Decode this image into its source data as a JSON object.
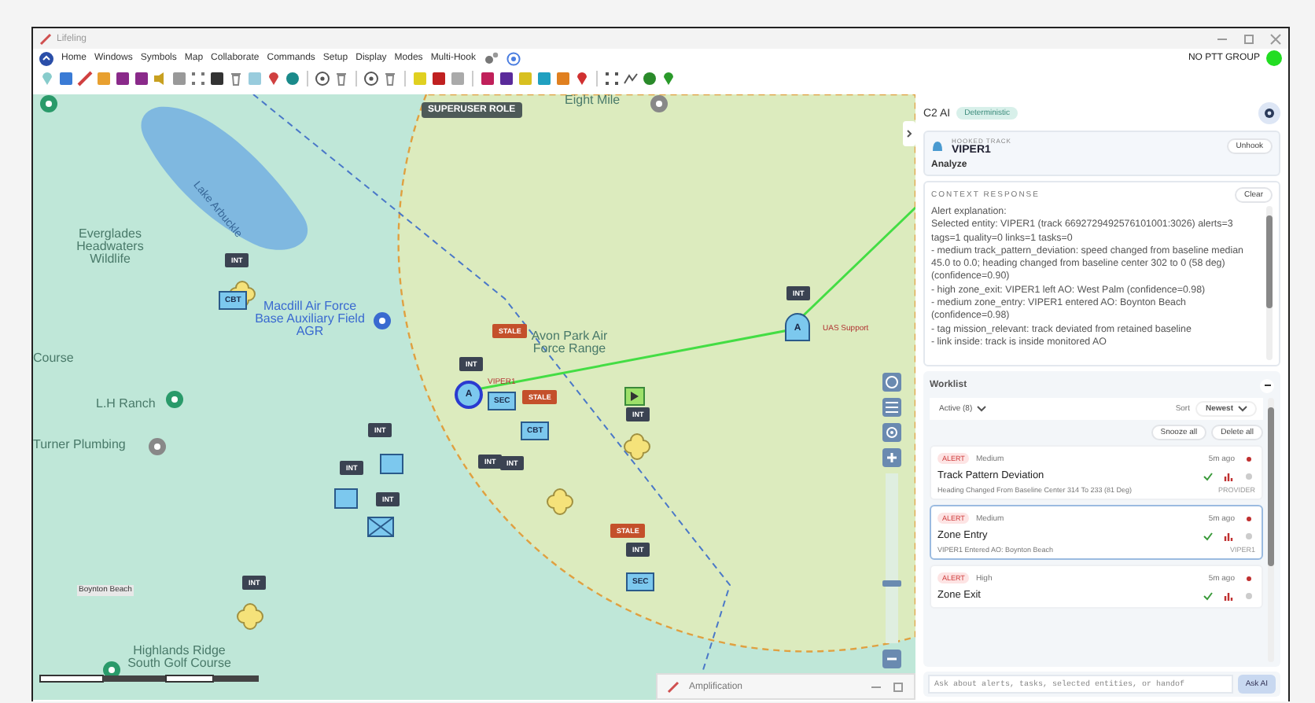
{
  "window": {
    "title": "Lifeling"
  },
  "menu": [
    "Home",
    "Windows",
    "Symbols",
    "Map",
    "Collaborate",
    "Commands",
    "Setup",
    "Display",
    "Modes",
    "Multi-Hook"
  ],
  "ptt_status": {
    "label": "NO PTT GROUP",
    "color": "#22dd22"
  },
  "map": {
    "role_badge": "SUPERUSER ROLE",
    "zoom": {
      "level": 0.35
    },
    "place_labels": [
      "Eight Mile",
      "Lake Arbuckle",
      "Everglades Headwaters Wildlife",
      "Macdill Air Force Base Auxiliary Field AGR",
      "Avon Park Air Force Range",
      "Course",
      "L.H Ranch",
      "Turner Plumbing",
      "Boynton Beach",
      "Highlands Ridge South Golf Course"
    ],
    "callsigns": [
      "VIPER1",
      "UAS Support"
    ],
    "markers": [
      {
        "kind": "tag",
        "text": "INT",
        "color": "#3b4352"
      },
      {
        "kind": "blob"
      },
      {
        "kind": "unit",
        "text": "CBT"
      },
      {
        "kind": "tag",
        "text": "INT",
        "color": "#3b4352"
      },
      {
        "kind": "ring",
        "text": "A"
      },
      {
        "kind": "tag",
        "text": "INT",
        "color": "#3b4352"
      },
      {
        "kind": "tag",
        "text": "INT",
        "color": "#3b4352"
      },
      {
        "kind": "square"
      },
      {
        "kind": "square"
      },
      {
        "kind": "tag",
        "text": "INT",
        "color": "#3b4352"
      },
      {
        "kind": "cross"
      },
      {
        "kind": "tag",
        "text": "INT",
        "color": "#3b4352"
      },
      {
        "kind": "blob"
      },
      {
        "kind": "tag",
        "text": "STALE",
        "color": "#c4502b"
      },
      {
        "kind": "tag",
        "text": "INT",
        "color": "#3b4352"
      },
      {
        "kind": "tag",
        "text": "INT",
        "color": "#3b4352"
      },
      {
        "kind": "unit",
        "text": "SEC"
      },
      {
        "kind": "tag",
        "text": "STALE",
        "color": "#c4502b"
      },
      {
        "kind": "unit",
        "text": "CBT"
      },
      {
        "kind": "blob"
      },
      {
        "kind": "tag",
        "text": "STALE",
        "color": "#c4502b"
      },
      {
        "kind": "tag",
        "text": "INT",
        "color": "#3b4352"
      },
      {
        "kind": "unit",
        "text": "SEC"
      },
      {
        "kind": "dome",
        "text": "A"
      },
      {
        "kind": "tag",
        "text": "INT",
        "color": "#3b4352"
      },
      {
        "kind": "green"
      },
      {
        "kind": "tag",
        "text": "INT",
        "color": "#3b4352"
      },
      {
        "kind": "blob"
      }
    ],
    "floating_window": {
      "title": "Amplification"
    }
  },
  "panel": {
    "title": "C2 AI",
    "mode_badge": "Deterministic",
    "hooked": {
      "label": "HOOKED TRACK",
      "name": "VIPER1",
      "unhook": "Unhook"
    },
    "analyze": "Analyze",
    "context": {
      "label": "CONTEXT RESPONSE",
      "clear": "Clear",
      "lines": [
        "Alert explanation:",
        "Selected entity: VIPER1 (track 6692729492576101001:3026) alerts=3 tags=1 quality=0 links=1 tasks=0",
        "- medium track_pattern_deviation: speed changed from baseline median 45.0 to 0.0; heading changed from baseline center 302 to 0 (58 deg) (confidence=0.90)",
        "- high zone_exit: VIPER1 left AO: West Palm (confidence=0.98)",
        "- medium zone_entry: VIPER1 entered AO: Boynton Beach (confidence=0.98)",
        "- tag mission_relevant: track deviated from retained baseline",
        "- link inside: track is inside monitored AO"
      ]
    },
    "worklist": {
      "title": "Worklist",
      "filter": "Active (8)",
      "sort_label": "Sort",
      "sort_value": "Newest",
      "snooze_all": "Snooze all",
      "delete_all": "Delete all",
      "items": [
        {
          "tag": "ALERT",
          "priority": "Medium",
          "time": "5m ago",
          "title": "Track Pattern Deviation",
          "detail": "Heading Changed From Baseline Center 314 To 233 (81 Deg)",
          "source": "PROVIDER",
          "selected": false
        },
        {
          "tag": "ALERT",
          "priority": "Medium",
          "time": "5m ago",
          "title": "Zone Entry",
          "detail": "VIPER1 Entered AO: Boynton Beach",
          "source": "VIPER1",
          "selected": true
        },
        {
          "tag": "ALERT",
          "priority": "High",
          "time": "5m ago",
          "title": "Zone Exit",
          "selected": false
        }
      ]
    },
    "ask": {
      "placeholder": "Ask about alerts, tasks, selected entities, or handof",
      "button": "Ask AI"
    }
  }
}
